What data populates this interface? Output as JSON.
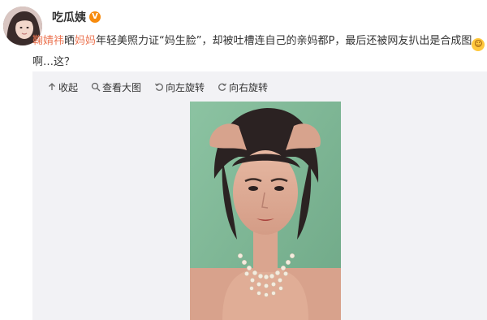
{
  "account": {
    "username": "吃瓜姨",
    "verified_badge": "V",
    "avatar_icon": "avatar-photo-girl"
  },
  "post": {
    "text_segments": [
      {
        "text": "鞠婧祎",
        "type": "mention"
      },
      {
        "text": "晒",
        "type": "plain"
      },
      {
        "text": "妈妈",
        "type": "mention"
      },
      {
        "text": "年轻美照力证“妈生脸”，却被吐槽连自己的亲妈都P，最后还被网友扒出是合成图",
        "type": "plain"
      },
      {
        "text": "😅",
        "type": "emoji"
      },
      {
        "text": "啊…这？",
        "type": "plain"
      }
    ],
    "mention_color": "#eb7350"
  },
  "toolbar": {
    "collapse_label": "收起",
    "view_large_label": "查看大图",
    "rotate_left_label": "向左旋转",
    "rotate_right_label": "向右旋转"
  },
  "image": {
    "description_icon": "woman-portrait-photo",
    "background_color": "#7fb796"
  }
}
